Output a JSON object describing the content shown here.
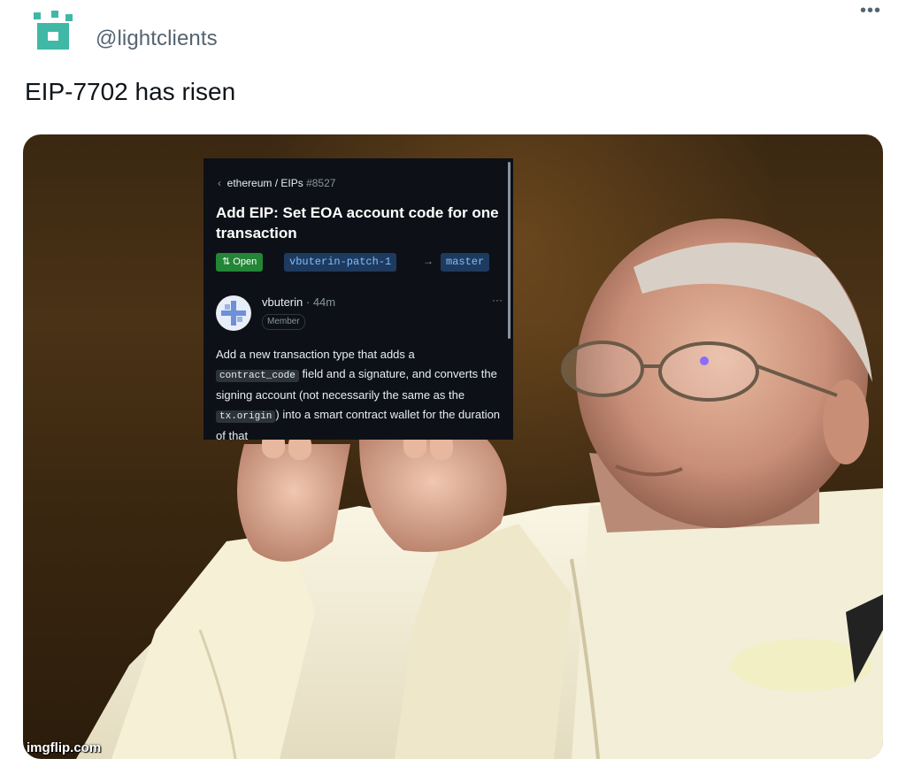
{
  "tweet": {
    "handle": "@lightclients",
    "text": "EIP-7702 has risen",
    "more_label": "•••",
    "avatar_icon": "pixel-logo-icon"
  },
  "media": {
    "watermark": "imgflip.com",
    "screenshot": {
      "breadcrumb_repo": "ethereum / EIPs",
      "breadcrumb_number": "#8527",
      "title": "Add EIP: Set EOA account code for one transaction",
      "status": "Open",
      "head_branch": "vbuterin-patch-1",
      "arrow": "→",
      "base_branch": "master",
      "author": "vbuterin",
      "time": "· 44m",
      "role": "Member",
      "menu": "···",
      "body_1": "Add a new transaction type that adds a ",
      "code_1": "contract_code",
      "body_2": " field and a signature, and converts the signing account (not necessarily the same as the ",
      "code_2": "tx.origin",
      "body_3": ") into a smart contract wallet for the duration of that"
    }
  },
  "colors": {
    "accent_logo": "#3fb8a6",
    "github_bg": "#0d1117",
    "open_badge": "#238636",
    "branch_text": "#79c0ff"
  }
}
